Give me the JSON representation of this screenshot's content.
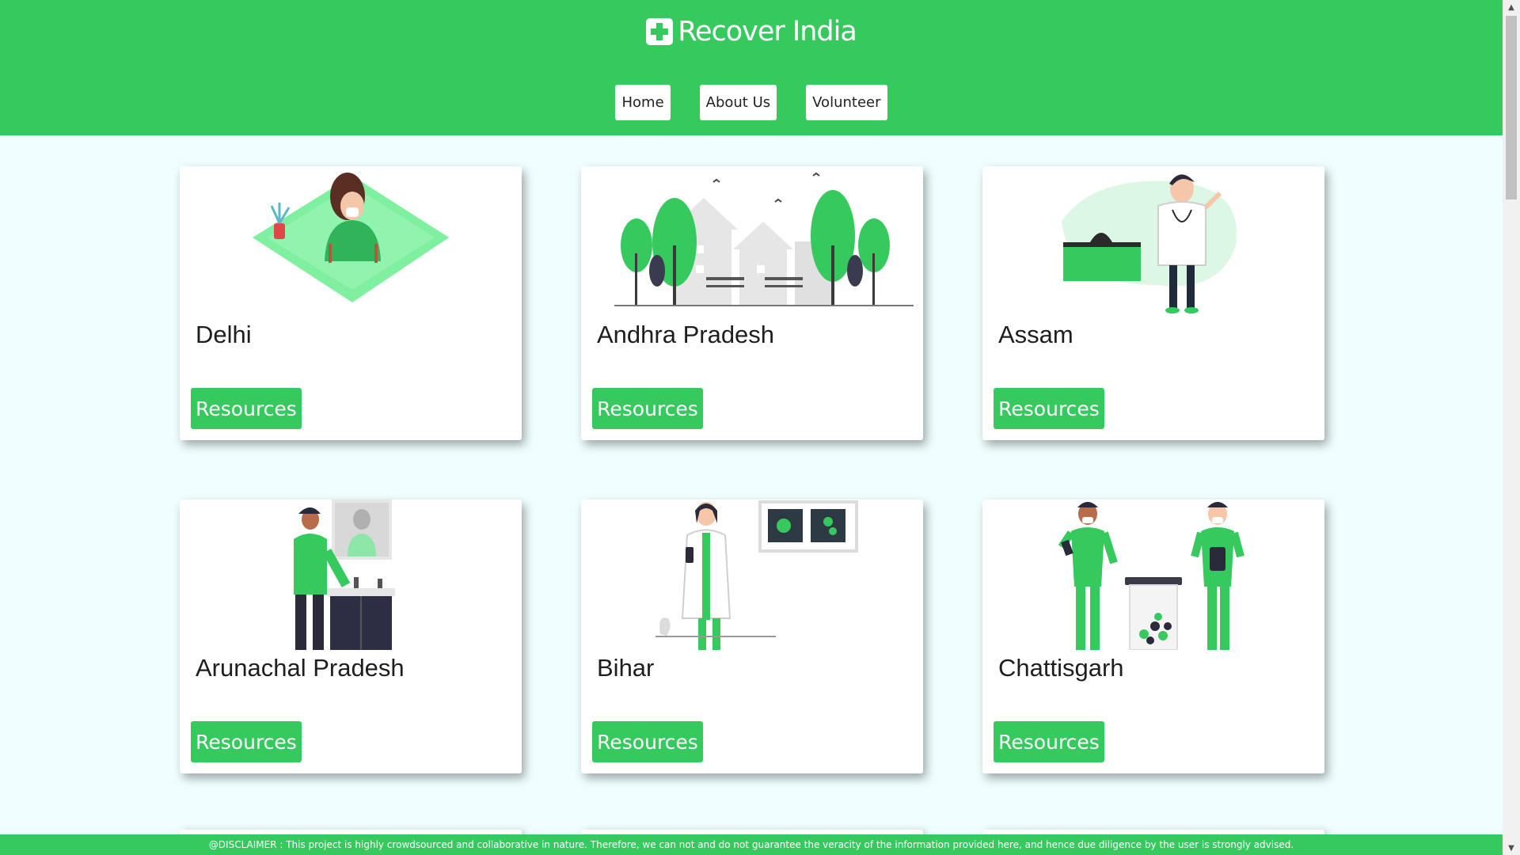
{
  "header": {
    "title": "Recover India",
    "logo_icon": "medical-plus-icon",
    "nav": [
      {
        "label": "Home"
      },
      {
        "label": "About Us"
      },
      {
        "label": "Volunteer"
      }
    ]
  },
  "cards": [
    {
      "state": "Delhi",
      "button": "Resources",
      "illustration": "masked-woman-illustration"
    },
    {
      "state": "Andhra Pradesh",
      "button": "Resources",
      "illustration": "park-city-illustration"
    },
    {
      "state": "Assam",
      "button": "Resources",
      "illustration": "doctor-illustration"
    },
    {
      "state": "Arunachal Pradesh",
      "button": "Resources",
      "illustration": "handwashing-illustration"
    },
    {
      "state": "Bihar",
      "button": "Resources",
      "illustration": "doctor-xray-illustration"
    },
    {
      "state": "Chattisgarh",
      "button": "Resources",
      "illustration": "nurses-pills-illustration"
    }
  ],
  "footer": {
    "disclaimer": "@DISCLAIMER : This project is highly crowdsourced and collaborative in nature. Therefore, we can not and do not guarantee the veracity of the information provided here, and hence due diligence by the user is strongly advised."
  },
  "colors": {
    "brand_green": "#36c95d",
    "page_background": "#f0feff",
    "card_background": "#ffffff"
  }
}
